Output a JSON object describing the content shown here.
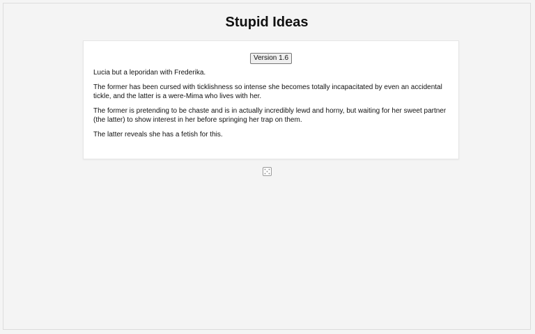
{
  "page": {
    "title": "Stupid Ideas"
  },
  "card": {
    "version_button": "Version 1.6",
    "paragraphs": [
      "Lucia but a leporidan with Frederika.",
      "The former has been cursed with ticklishness so intense she becomes totally incapacitated by even an accidental tickle, and the latter is a were-Mima who lives with her.",
      "The former is pretending to be chaste and is in actually incredibly lewd and horny, but waiting for her sweet partner (the latter) to show interest in her before springing her trap on them.",
      "The latter reveals she has a fetish for this."
    ]
  },
  "icons": {
    "randomize": "dice-icon"
  }
}
